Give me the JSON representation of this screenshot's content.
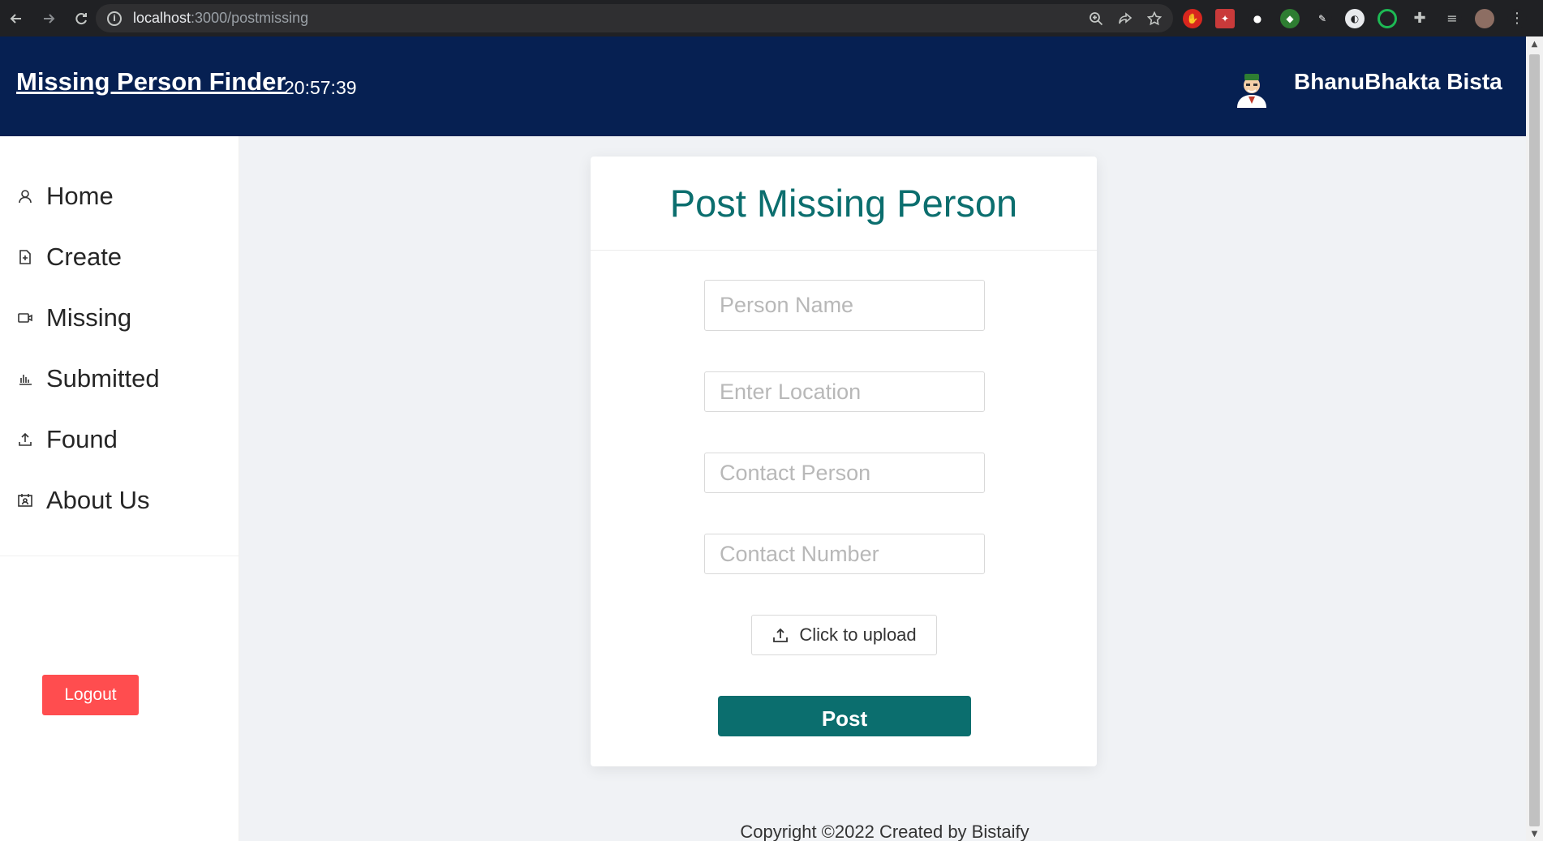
{
  "browser": {
    "url_host": "localhost",
    "url_path": ":3000/postmissing",
    "info_glyph": "i"
  },
  "header": {
    "app_title": "Missing Person Finder",
    "clock": "20:57:39",
    "user_name": "BhanuBhakta Bista"
  },
  "sidebar": {
    "items": [
      {
        "label": "Home",
        "icon": "user-icon"
      },
      {
        "label": "Create",
        "icon": "file-add-icon"
      },
      {
        "label": "Missing",
        "icon": "video-camera-icon"
      },
      {
        "label": "Submitted",
        "icon": "bar-chart-icon"
      },
      {
        "label": "Found",
        "icon": "upload-icon"
      },
      {
        "label": "About Us",
        "icon": "contacts-icon"
      }
    ],
    "logout_label": "Logout"
  },
  "form": {
    "title": "Post Missing Person",
    "person_name_placeholder": "Person Name",
    "location_placeholder": "Enter Location",
    "contact_person_placeholder": "Contact Person",
    "contact_number_placeholder": "Contact Number",
    "upload_label": "Click to upload",
    "post_label": "Post"
  },
  "footer": {
    "text": "Copyright ©2022 Created by Bistaify"
  },
  "colors": {
    "header_bg": "#062052",
    "accent_teal": "#0b6e6e",
    "logout_red": "#ff4d4f",
    "page_bg": "#f0f2f5"
  }
}
